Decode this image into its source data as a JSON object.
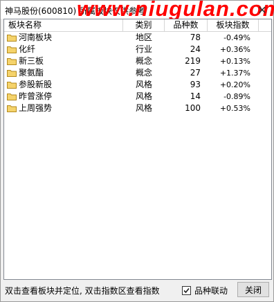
{
  "window": {
    "title": "神马股份(600810)  所属板块仅供参考",
    "close_glyph": "✕"
  },
  "watermark": "www.niugulan.com",
  "table": {
    "columns": [
      "板块名称",
      "类别",
      "品种数",
      "板块指数"
    ],
    "rows": [
      {
        "name": "河南板块",
        "type": "地区",
        "count": "78",
        "index": "-0.49%"
      },
      {
        "name": "化纤",
        "type": "行业",
        "count": "24",
        "index": "+0.36%"
      },
      {
        "name": "新三板",
        "type": "概念",
        "count": "219",
        "index": "+0.13%"
      },
      {
        "name": "聚氨酯",
        "type": "概念",
        "count": "27",
        "index": "+1.37%"
      },
      {
        "name": "参股新股",
        "type": "风格",
        "count": "93",
        "index": "+0.20%"
      },
      {
        "name": "昨曾涨停",
        "type": "风格",
        "count": "14",
        "index": "-0.89%"
      },
      {
        "name": "上周强势",
        "type": "风格",
        "count": "100",
        "index": "+0.53%"
      }
    ]
  },
  "statusbar": {
    "hint": "双击查看板块并定位, 双击指数区查看指数",
    "checkbox_label": "品种联动",
    "checkbox_checked": true,
    "close_label": "关闭"
  },
  "icons": {
    "row_icon": "folder-icon",
    "folder_color": "#f5d36b",
    "folder_border": "#b38a1d",
    "watermark_color": "#ff0000"
  }
}
